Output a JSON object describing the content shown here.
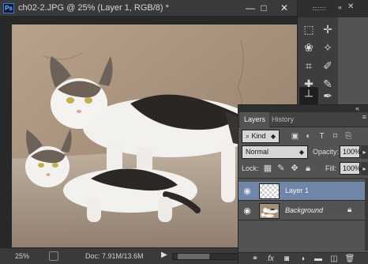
{
  "document": {
    "app_logo": "Ps",
    "title": "ch02-2.JPG @ 25% (Layer 1, RGB/8) *",
    "window_buttons": {
      "minimize": "—",
      "maximize": "□",
      "close": "✕"
    }
  },
  "status_bar": {
    "zoom": "25%",
    "doc_info": "Doc: 7.91M/13.6M",
    "arrow": "▶"
  },
  "tools_panel": {
    "close": "✕",
    "collapse": "«",
    "tools": [
      {
        "name": "rectangular-marquee-icon",
        "glyph": "⬚"
      },
      {
        "name": "move-icon",
        "glyph": "✛"
      },
      {
        "name": "lasso-icon",
        "glyph": "❀"
      },
      {
        "name": "magic-wand-icon",
        "glyph": "✧"
      },
      {
        "name": "crop-icon",
        "glyph": "⌗"
      },
      {
        "name": "eyedropper-icon",
        "glyph": "✐"
      },
      {
        "name": "spot-healing-icon",
        "glyph": "✚"
      },
      {
        "name": "brush-icon",
        "glyph": "✎"
      },
      {
        "name": "clone-stamp-icon",
        "glyph": "┴"
      },
      {
        "name": "history-brush-icon",
        "glyph": "✒"
      }
    ]
  },
  "layers_panel": {
    "collapse": "«",
    "tabs": [
      {
        "label": "Layers"
      },
      {
        "label": "History"
      }
    ],
    "menu_icon": "≡",
    "filter": {
      "kind_label": "Kind"
    },
    "blend_mode": "Normal",
    "opacity_label": "Opacity:",
    "opacity_value": "100%",
    "lock_label": "Lock:",
    "fill_label": "Fill:",
    "fill_value": "100%",
    "layers": [
      {
        "name": "Layer 1",
        "selected": true,
        "visible": true
      },
      {
        "name": "Background",
        "selected": false,
        "visible": true,
        "locked": true
      }
    ]
  },
  "colors": {
    "selected_layer": "#6f86a8",
    "panel_bg": "#535353",
    "chrome_dark": "#3a3a3a"
  }
}
